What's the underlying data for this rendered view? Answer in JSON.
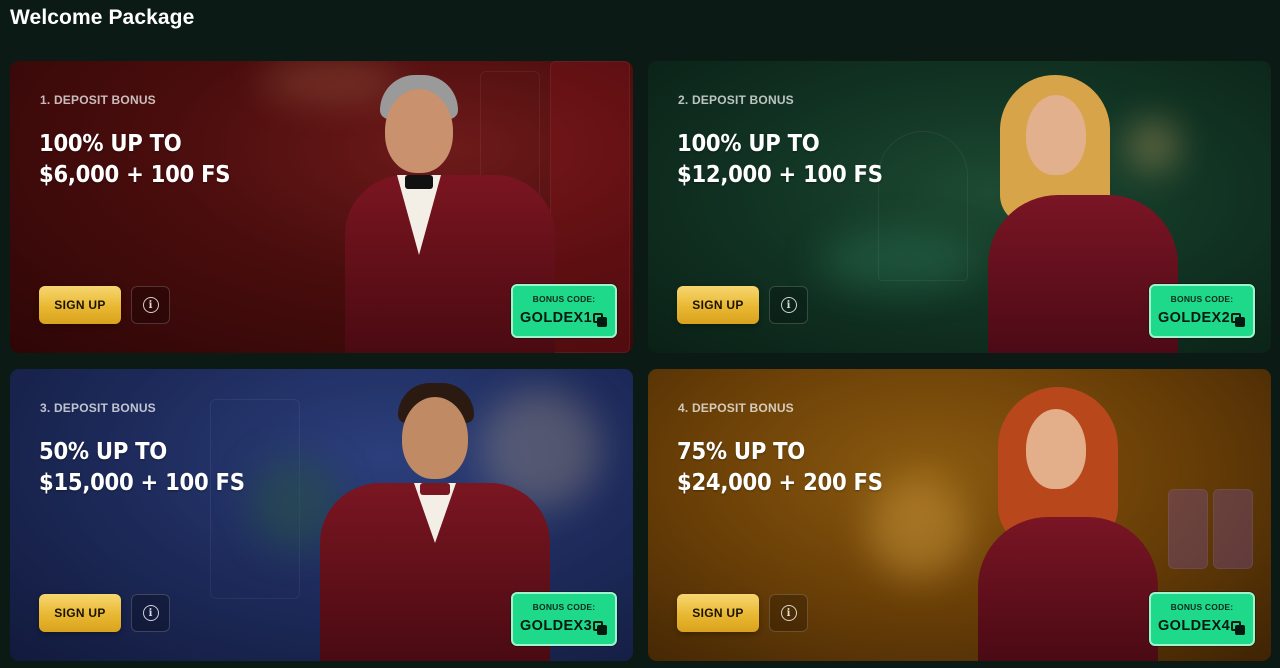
{
  "page": {
    "title": "Welcome Package"
  },
  "colors": {
    "accent_gold": "#e9b832",
    "code_green": "#1fd98a",
    "card_red": "#4a0d0d",
    "card_green": "#123524",
    "card_blue": "#1d2a5a",
    "card_gold": "#6a3f07"
  },
  "cards": [
    {
      "label": "1. DEPOSIT BONUS",
      "headline_line1": "100% UP TO",
      "headline_line2": "$6,000 + 100 FS",
      "signup_label": "SIGN UP",
      "info_icon": "info-icon",
      "code_title": "BONUS CODE:",
      "code_value": "GOLDEX1",
      "copy_icon": "copy-icon"
    },
    {
      "label": "2. DEPOSIT BONUS",
      "headline_line1": "100% UP TO",
      "headline_line2": "$12,000 + 100 FS",
      "signup_label": "SIGN UP",
      "info_icon": "info-icon",
      "code_title": "BONUS CODE:",
      "code_value": "GOLDEX2",
      "copy_icon": "copy-icon"
    },
    {
      "label": "3. DEPOSIT BONUS",
      "headline_line1": "50% UP TO",
      "headline_line2": "$15,000 + 100 FS",
      "signup_label": "SIGN UP",
      "info_icon": "info-icon",
      "code_title": "BONUS CODE:",
      "code_value": "GOLDEX3",
      "copy_icon": "copy-icon"
    },
    {
      "label": "4. DEPOSIT BONUS",
      "headline_line1": "75% UP TO",
      "headline_line2": "$24,000 + 200 FS",
      "signup_label": "SIGN UP",
      "info_icon": "info-icon",
      "code_title": "BONUS CODE:",
      "code_value": "GOLDEX4",
      "copy_icon": "copy-icon"
    }
  ]
}
